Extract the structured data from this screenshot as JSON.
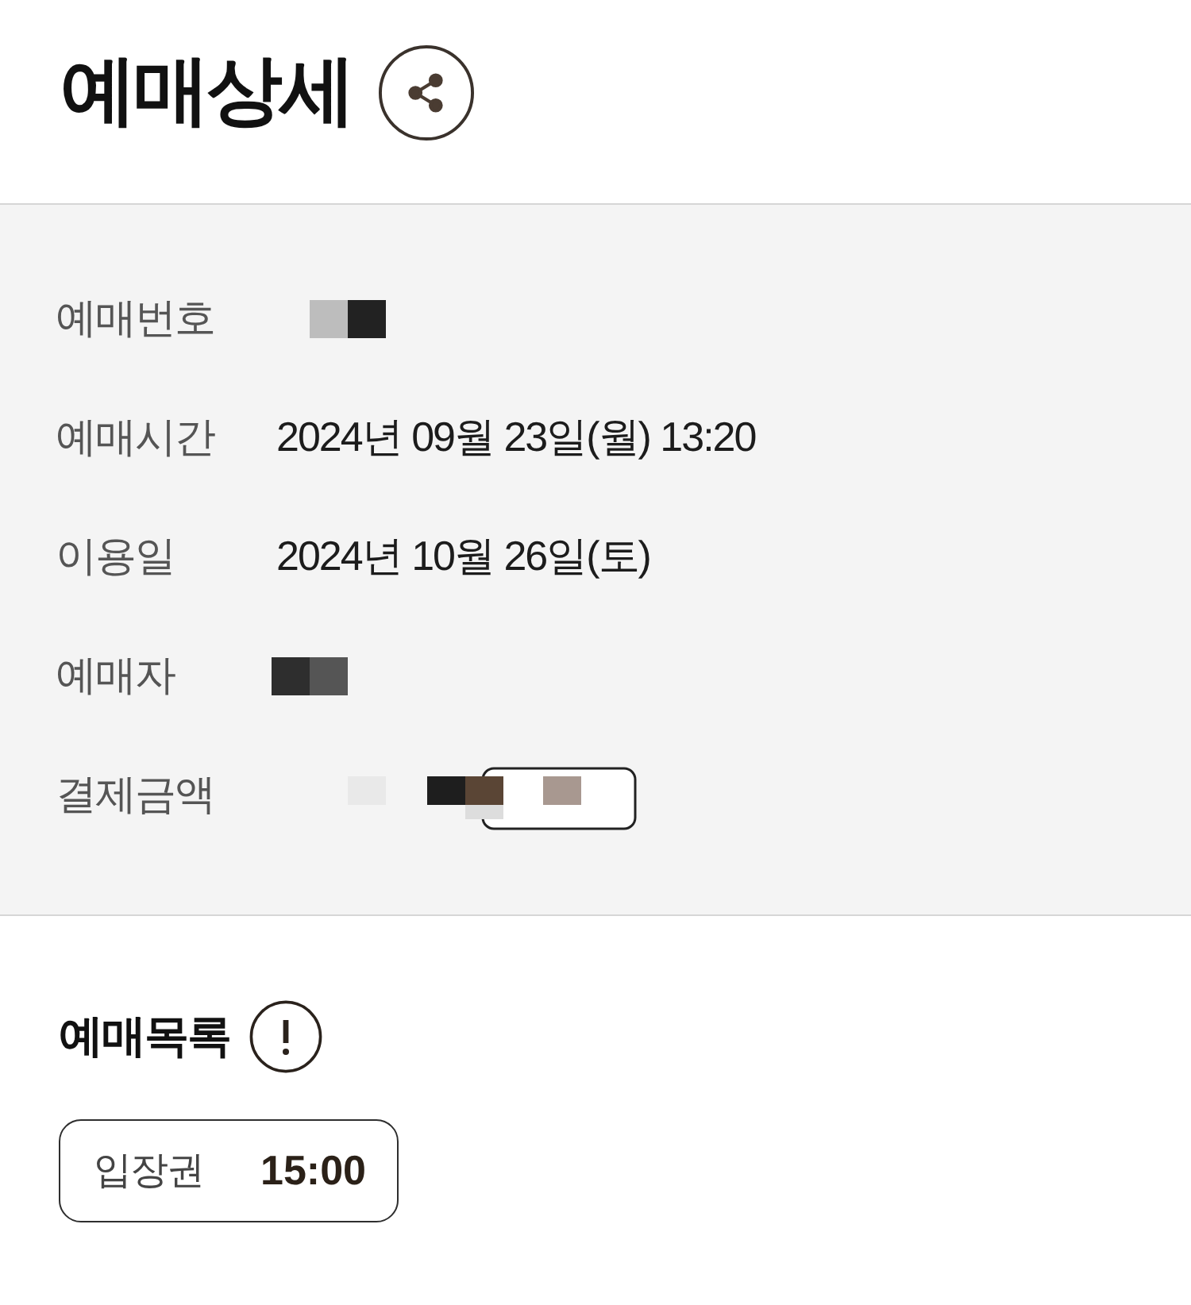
{
  "title": "예매상세",
  "details": [
    {
      "label": "예매번호",
      "kind": "redacted"
    },
    {
      "label": "예매시간",
      "kind": "text",
      "value": "2024년 09월 23일(월) 13:20"
    },
    {
      "label": "이용일",
      "kind": "text",
      "value": "2024년 10월 26일(토)"
    },
    {
      "label": "예매자",
      "kind": "redacted"
    },
    {
      "label": "결제금액",
      "kind": "redacted"
    }
  ],
  "booking_list": {
    "title": "예매목록",
    "items": [
      {
        "label": "입장권",
        "time": "15:00"
      }
    ]
  }
}
